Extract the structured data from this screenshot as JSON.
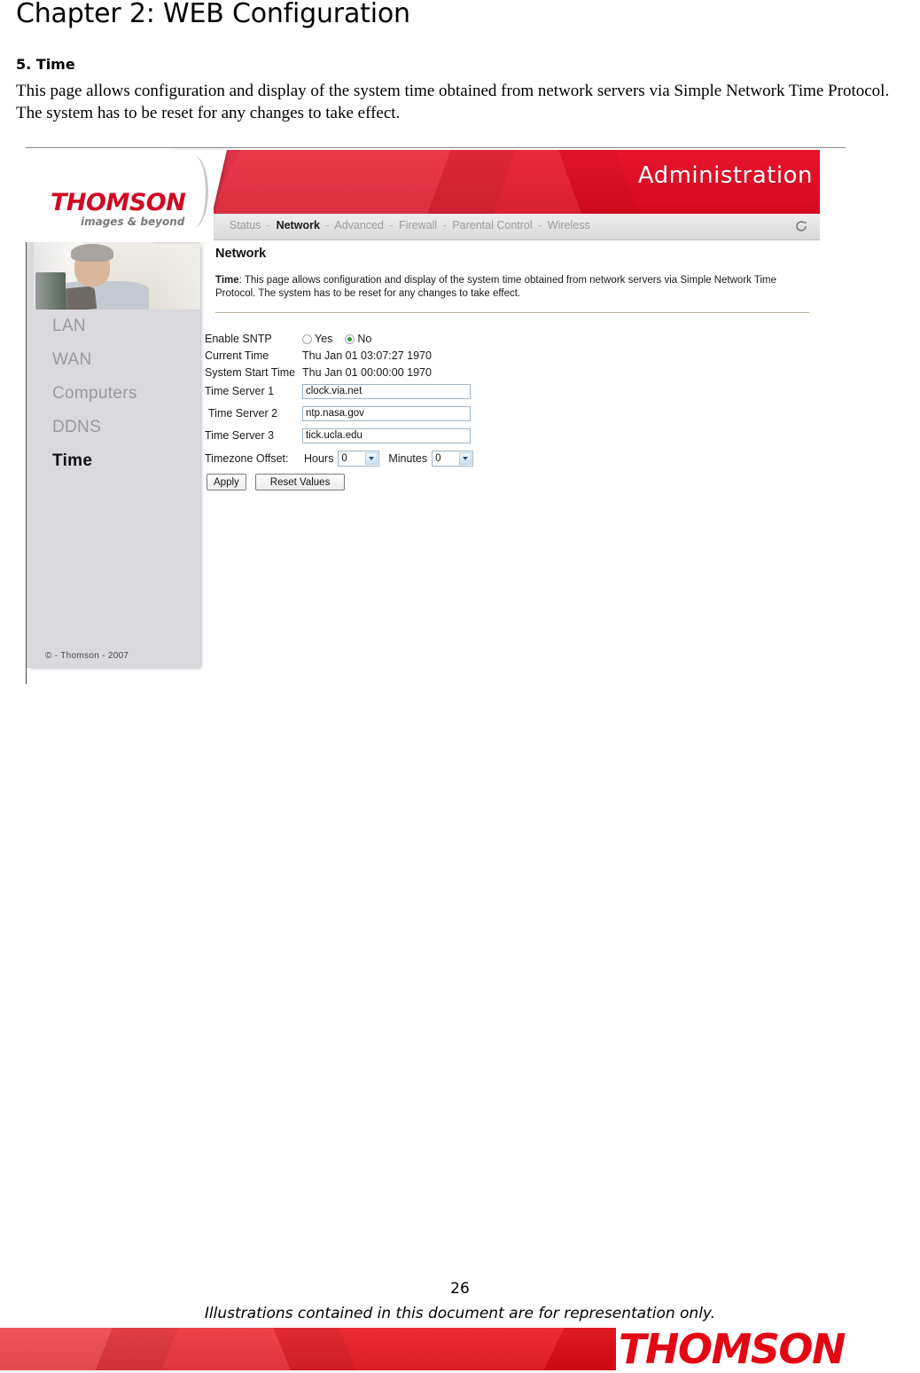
{
  "document": {
    "chapter_title": "Chapter 2: WEB Configuration",
    "section_title": "5. Time",
    "intro_paragraph": "This page allows configuration and display of the system time obtained from network servers via Simple Network Time Protocol. The system has to be reset for any changes to take effect.",
    "page_number": "26",
    "footer_note": "Illustrations contained in this document are for representation only.",
    "footer_brand": "THOMSON"
  },
  "screenshot": {
    "logo": {
      "wordmark": "THOMSON",
      "tagline": "images & beyond"
    },
    "banner": {
      "title": "Administration",
      "color": "#dd0b24"
    },
    "nav": {
      "items": [
        {
          "label": "Status",
          "active": false
        },
        {
          "label": "Network",
          "active": true
        },
        {
          "label": "Advanced",
          "active": false
        },
        {
          "label": "Firewall",
          "active": false
        },
        {
          "label": "Parental Control",
          "active": false
        },
        {
          "label": "Wireless",
          "active": false
        }
      ],
      "separator": "-",
      "refresh_icon": "refresh-icon"
    },
    "sidebar": {
      "items": [
        {
          "label": "LAN",
          "active": false
        },
        {
          "label": "WAN",
          "active": false
        },
        {
          "label": "Computers",
          "active": false
        },
        {
          "label": "DDNS",
          "active": false
        },
        {
          "label": "Time",
          "active": true
        }
      ],
      "copyright": "© - Thomson - 2007"
    },
    "content": {
      "title": "Network",
      "desc_label": "Time",
      "desc_colon": ":",
      "desc_text": "This page allows configuration and display of the system time obtained from network servers via Simple Network Time Protocol. The system has to be reset for any changes to take effect.",
      "form": {
        "enable_sntp": {
          "label": "Enable SNTP",
          "yes_label": "Yes",
          "no_label": "No",
          "selected": "No"
        },
        "current_time": {
          "label": "Current Time",
          "value": "Thu Jan 01 03:07:27 1970"
        },
        "system_start_time": {
          "label": "System Start Time",
          "value": "Thu Jan 01 00:00:00 1970"
        },
        "time_server_1": {
          "label": "Time Server 1",
          "value": "clock.via.net"
        },
        "time_server_2": {
          "label": "Time Server 2",
          "value": "ntp.nasa.gov"
        },
        "time_server_3": {
          "label": "Time Server 3",
          "value": "tick.ucla.edu"
        },
        "timezone_offset": {
          "label": "Timezone Offset:",
          "hours_label": "Hours",
          "hours_value": "0",
          "minutes_label": "Minutes",
          "minutes_value": "0"
        },
        "apply_button": "Apply",
        "reset_button": "Reset Values"
      }
    }
  }
}
